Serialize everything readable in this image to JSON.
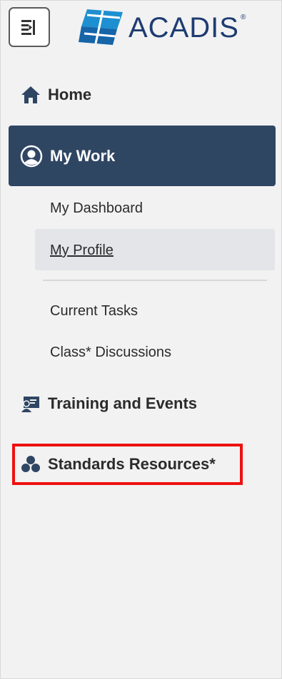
{
  "brand": {
    "name": "ACADIS",
    "reg": "®",
    "color": "#1e3c72"
  },
  "header": {
    "toggle_icon": "sidebar-collapse-icon"
  },
  "nav": {
    "home": {
      "label": "Home",
      "icon": "home-icon"
    },
    "my_work": {
      "label": "My Work",
      "icon": "user-circle-icon",
      "active": true,
      "bg": "#2f4663"
    },
    "sub_items": [
      {
        "label": "My Dashboard"
      },
      {
        "label": "My Profile",
        "selected": true
      },
      {
        "label": "Current Tasks"
      },
      {
        "label": "Class* Discussions"
      }
    ],
    "training": {
      "label": "Training and Events",
      "icon": "presentation-icon"
    },
    "standards": {
      "label": "Standards Resources*",
      "icon": "cubes-icon",
      "highlighted": true
    }
  },
  "colors": {
    "highlight": "#ee1111",
    "background": "#f2f2f2",
    "selected_bg": "#e3e5e8"
  }
}
